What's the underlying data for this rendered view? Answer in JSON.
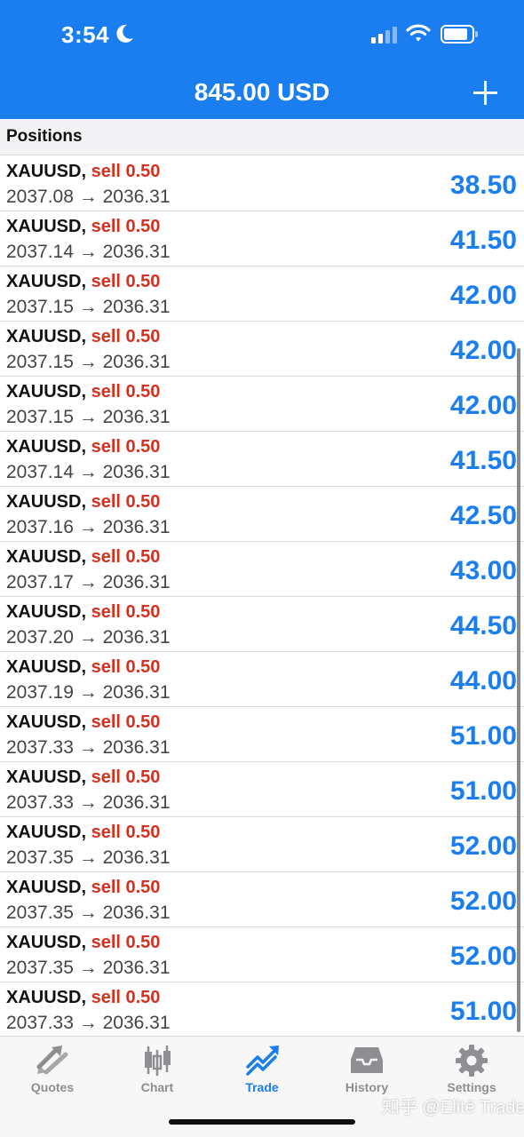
{
  "status": {
    "time": "3:54"
  },
  "header": {
    "title": "845.00 USD"
  },
  "section": {
    "title": "Positions"
  },
  "positions": [
    {
      "symbol": "XAUUSD,",
      "side": "sell 0.50",
      "open_price": "2037.08",
      "current_price": "2036.31",
      "profit": "38.50"
    },
    {
      "symbol": "XAUUSD,",
      "side": "sell 0.50",
      "open_price": "2037.14",
      "current_price": "2036.31",
      "profit": "41.50"
    },
    {
      "symbol": "XAUUSD,",
      "side": "sell 0.50",
      "open_price": "2037.15",
      "current_price": "2036.31",
      "profit": "42.00"
    },
    {
      "symbol": "XAUUSD,",
      "side": "sell 0.50",
      "open_price": "2037.15",
      "current_price": "2036.31",
      "profit": "42.00"
    },
    {
      "symbol": "XAUUSD,",
      "side": "sell 0.50",
      "open_price": "2037.15",
      "current_price": "2036.31",
      "profit": "42.00"
    },
    {
      "symbol": "XAUUSD,",
      "side": "sell 0.50",
      "open_price": "2037.14",
      "current_price": "2036.31",
      "profit": "41.50"
    },
    {
      "symbol": "XAUUSD,",
      "side": "sell 0.50",
      "open_price": "2037.16",
      "current_price": "2036.31",
      "profit": "42.50"
    },
    {
      "symbol": "XAUUSD,",
      "side": "sell 0.50",
      "open_price": "2037.17",
      "current_price": "2036.31",
      "profit": "43.00"
    },
    {
      "symbol": "XAUUSD,",
      "side": "sell 0.50",
      "open_price": "2037.20",
      "current_price": "2036.31",
      "profit": "44.50"
    },
    {
      "symbol": "XAUUSD,",
      "side": "sell 0.50",
      "open_price": "2037.19",
      "current_price": "2036.31",
      "profit": "44.00"
    },
    {
      "symbol": "XAUUSD,",
      "side": "sell 0.50",
      "open_price": "2037.33",
      "current_price": "2036.31",
      "profit": "51.00"
    },
    {
      "symbol": "XAUUSD,",
      "side": "sell 0.50",
      "open_price": "2037.33",
      "current_price": "2036.31",
      "profit": "51.00"
    },
    {
      "symbol": "XAUUSD,",
      "side": "sell 0.50",
      "open_price": "2037.35",
      "current_price": "2036.31",
      "profit": "52.00"
    },
    {
      "symbol": "XAUUSD,",
      "side": "sell 0.50",
      "open_price": "2037.35",
      "current_price": "2036.31",
      "profit": "52.00"
    },
    {
      "symbol": "XAUUSD,",
      "side": "sell 0.50",
      "open_price": "2037.35",
      "current_price": "2036.31",
      "profit": "52.00"
    },
    {
      "symbol": "XAUUSD,",
      "side": "sell 0.50",
      "open_price": "2037.33",
      "current_price": "2036.31",
      "profit": "51.00"
    }
  ],
  "price_arrow": "→",
  "tabs": [
    {
      "label": "Quotes",
      "icon": "quotes-arrows-icon",
      "active": false
    },
    {
      "label": "Chart",
      "icon": "candlestick-chart-icon",
      "active": false
    },
    {
      "label": "Trade",
      "icon": "trade-trend-icon",
      "active": true
    },
    {
      "label": "History",
      "icon": "history-inbox-icon",
      "active": false
    },
    {
      "label": "Settings",
      "icon": "gear-icon",
      "active": false
    }
  ],
  "watermark": "知乎 @Elitē Trader",
  "colors": {
    "brand_blue": "#1a7ef0",
    "sell_red": "#d6301f",
    "tab_inactive": "#8e8e93"
  }
}
